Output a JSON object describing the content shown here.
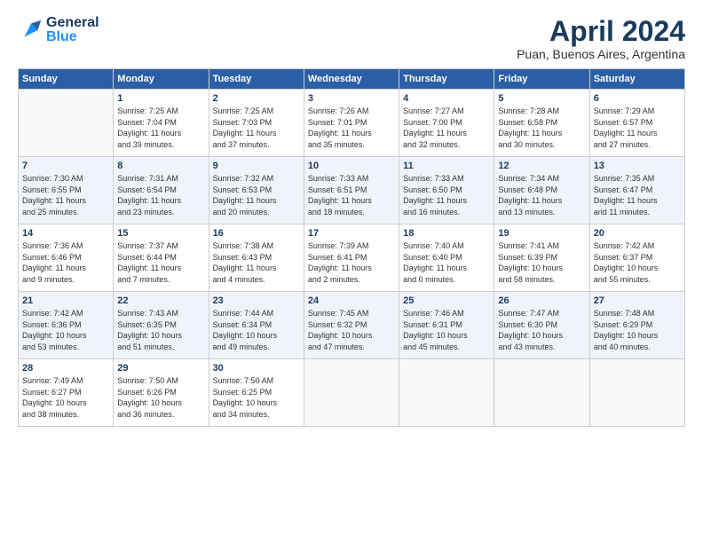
{
  "header": {
    "logo_general": "General",
    "logo_blue": "Blue",
    "title": "April 2024",
    "subtitle": "Puan, Buenos Aires, Argentina"
  },
  "weekdays": [
    "Sunday",
    "Monday",
    "Tuesday",
    "Wednesday",
    "Thursday",
    "Friday",
    "Saturday"
  ],
  "weeks": [
    [
      {
        "day": "",
        "sunrise": "",
        "sunset": "",
        "daylight": ""
      },
      {
        "day": "1",
        "sunrise": "Sunrise: 7:25 AM",
        "sunset": "Sunset: 7:04 PM",
        "daylight": "Daylight: 11 hours and 39 minutes."
      },
      {
        "day": "2",
        "sunrise": "Sunrise: 7:25 AM",
        "sunset": "Sunset: 7:03 PM",
        "daylight": "Daylight: 11 hours and 37 minutes."
      },
      {
        "day": "3",
        "sunrise": "Sunrise: 7:26 AM",
        "sunset": "Sunset: 7:01 PM",
        "daylight": "Daylight: 11 hours and 35 minutes."
      },
      {
        "day": "4",
        "sunrise": "Sunrise: 7:27 AM",
        "sunset": "Sunset: 7:00 PM",
        "daylight": "Daylight: 11 hours and 32 minutes."
      },
      {
        "day": "5",
        "sunrise": "Sunrise: 7:28 AM",
        "sunset": "Sunset: 6:58 PM",
        "daylight": "Daylight: 11 hours and 30 minutes."
      },
      {
        "day": "6",
        "sunrise": "Sunrise: 7:29 AM",
        "sunset": "Sunset: 6:57 PM",
        "daylight": "Daylight: 11 hours and 27 minutes."
      }
    ],
    [
      {
        "day": "7",
        "sunrise": "Sunrise: 7:30 AM",
        "sunset": "Sunset: 6:55 PM",
        "daylight": "Daylight: 11 hours and 25 minutes."
      },
      {
        "day": "8",
        "sunrise": "Sunrise: 7:31 AM",
        "sunset": "Sunset: 6:54 PM",
        "daylight": "Daylight: 11 hours and 23 minutes."
      },
      {
        "day": "9",
        "sunrise": "Sunrise: 7:32 AM",
        "sunset": "Sunset: 6:53 PM",
        "daylight": "Daylight: 11 hours and 20 minutes."
      },
      {
        "day": "10",
        "sunrise": "Sunrise: 7:33 AM",
        "sunset": "Sunset: 6:51 PM",
        "daylight": "Daylight: 11 hours and 18 minutes."
      },
      {
        "day": "11",
        "sunrise": "Sunrise: 7:33 AM",
        "sunset": "Sunset: 6:50 PM",
        "daylight": "Daylight: 11 hours and 16 minutes."
      },
      {
        "day": "12",
        "sunrise": "Sunrise: 7:34 AM",
        "sunset": "Sunset: 6:48 PM",
        "daylight": "Daylight: 11 hours and 13 minutes."
      },
      {
        "day": "13",
        "sunrise": "Sunrise: 7:35 AM",
        "sunset": "Sunset: 6:47 PM",
        "daylight": "Daylight: 11 hours and 11 minutes."
      }
    ],
    [
      {
        "day": "14",
        "sunrise": "Sunrise: 7:36 AM",
        "sunset": "Sunset: 6:46 PM",
        "daylight": "Daylight: 11 hours and 9 minutes."
      },
      {
        "day": "15",
        "sunrise": "Sunrise: 7:37 AM",
        "sunset": "Sunset: 6:44 PM",
        "daylight": "Daylight: 11 hours and 7 minutes."
      },
      {
        "day": "16",
        "sunrise": "Sunrise: 7:38 AM",
        "sunset": "Sunset: 6:43 PM",
        "daylight": "Daylight: 11 hours and 4 minutes."
      },
      {
        "day": "17",
        "sunrise": "Sunrise: 7:39 AM",
        "sunset": "Sunset: 6:41 PM",
        "daylight": "Daylight: 11 hours and 2 minutes."
      },
      {
        "day": "18",
        "sunrise": "Sunrise: 7:40 AM",
        "sunset": "Sunset: 6:40 PM",
        "daylight": "Daylight: 11 hours and 0 minutes."
      },
      {
        "day": "19",
        "sunrise": "Sunrise: 7:41 AM",
        "sunset": "Sunset: 6:39 PM",
        "daylight": "Daylight: 10 hours and 58 minutes."
      },
      {
        "day": "20",
        "sunrise": "Sunrise: 7:42 AM",
        "sunset": "Sunset: 6:37 PM",
        "daylight": "Daylight: 10 hours and 55 minutes."
      }
    ],
    [
      {
        "day": "21",
        "sunrise": "Sunrise: 7:42 AM",
        "sunset": "Sunset: 6:36 PM",
        "daylight": "Daylight: 10 hours and 53 minutes."
      },
      {
        "day": "22",
        "sunrise": "Sunrise: 7:43 AM",
        "sunset": "Sunset: 6:35 PM",
        "daylight": "Daylight: 10 hours and 51 minutes."
      },
      {
        "day": "23",
        "sunrise": "Sunrise: 7:44 AM",
        "sunset": "Sunset: 6:34 PM",
        "daylight": "Daylight: 10 hours and 49 minutes."
      },
      {
        "day": "24",
        "sunrise": "Sunrise: 7:45 AM",
        "sunset": "Sunset: 6:32 PM",
        "daylight": "Daylight: 10 hours and 47 minutes."
      },
      {
        "day": "25",
        "sunrise": "Sunrise: 7:46 AM",
        "sunset": "Sunset: 6:31 PM",
        "daylight": "Daylight: 10 hours and 45 minutes."
      },
      {
        "day": "26",
        "sunrise": "Sunrise: 7:47 AM",
        "sunset": "Sunset: 6:30 PM",
        "daylight": "Daylight: 10 hours and 43 minutes."
      },
      {
        "day": "27",
        "sunrise": "Sunrise: 7:48 AM",
        "sunset": "Sunset: 6:29 PM",
        "daylight": "Daylight: 10 hours and 40 minutes."
      }
    ],
    [
      {
        "day": "28",
        "sunrise": "Sunrise: 7:49 AM",
        "sunset": "Sunset: 6:27 PM",
        "daylight": "Daylight: 10 hours and 38 minutes."
      },
      {
        "day": "29",
        "sunrise": "Sunrise: 7:50 AM",
        "sunset": "Sunset: 6:26 PM",
        "daylight": "Daylight: 10 hours and 36 minutes."
      },
      {
        "day": "30",
        "sunrise": "Sunrise: 7:50 AM",
        "sunset": "Sunset: 6:25 PM",
        "daylight": "Daylight: 10 hours and 34 minutes."
      },
      {
        "day": "",
        "sunrise": "",
        "sunset": "",
        "daylight": ""
      },
      {
        "day": "",
        "sunrise": "",
        "sunset": "",
        "daylight": ""
      },
      {
        "day": "",
        "sunrise": "",
        "sunset": "",
        "daylight": ""
      },
      {
        "day": "",
        "sunrise": "",
        "sunset": "",
        "daylight": ""
      }
    ]
  ]
}
